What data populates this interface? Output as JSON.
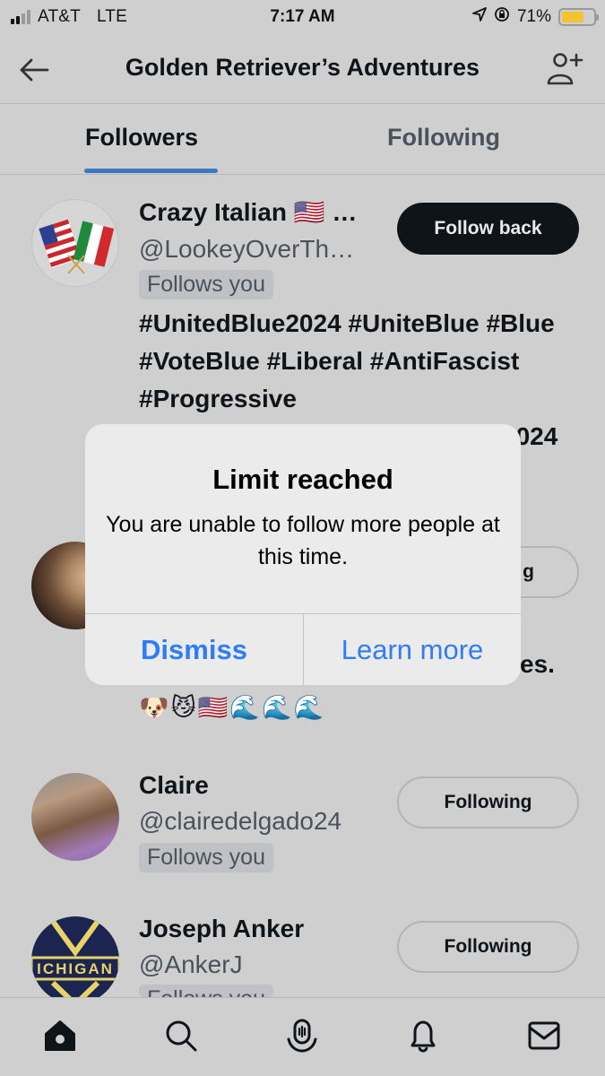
{
  "status_bar": {
    "carrier": "AT&T",
    "network": "LTE",
    "time": "7:17 AM",
    "battery_percent_label": "71%",
    "battery_level": 0.71,
    "signal_bars_active": 2,
    "signal_bars_total": 4,
    "icons": [
      "location-arrow-icon",
      "rotation-lock-icon",
      "battery-icon"
    ]
  },
  "header": {
    "title": "Golden Retriever’s Adventures",
    "back_icon": "arrow-left-icon",
    "add_user_icon": "person-plus-icon"
  },
  "tabs": [
    {
      "label": "Followers",
      "active": true
    },
    {
      "label": "Following",
      "active": false
    }
  ],
  "users": [
    {
      "name": "Crazy Italian 🇺🇸 …",
      "handle": "@LookeyOverTh…",
      "badge": "Follows you",
      "button": "Follow back",
      "bio": "#UnitedBlue2024 #UniteBlue #Blue #VoteBlue #Liberal #AntiFascist #Progressive",
      "bio_overflow": "2024",
      "avatar": "us-italy-flags-avatar"
    },
    {
      "name": "",
      "handle": "",
      "button_partial": "g",
      "bio_tail": "es.",
      "emojis": "🐶😼🇺🇸🌊🌊🌊",
      "avatar": "woman-blonde-avatar"
    },
    {
      "name": "Claire",
      "handle": "@clairedelgado24",
      "badge": "Follows you",
      "button": "Following",
      "avatar": "woman-purple-top-avatar"
    },
    {
      "name": "Joseph Anker",
      "handle": "@AnkerJ",
      "badge": "Follows you",
      "button": "Following",
      "avatar": "michigan-logo-avatar"
    }
  ],
  "alert": {
    "title": "Limit reached",
    "message": "You are unable to follow more people at this time.",
    "dismiss_label": "Dismiss",
    "learn_more_label": "Learn more",
    "accent_color": "#2e7cf6"
  },
  "bottom_nav": [
    {
      "name": "home",
      "icon": "home-icon",
      "active": true
    },
    {
      "name": "search",
      "icon": "search-icon",
      "active": false
    },
    {
      "name": "spaces",
      "icon": "spaces-microphone-icon",
      "active": false
    },
    {
      "name": "notifications",
      "icon": "bell-icon",
      "active": false
    },
    {
      "name": "messages",
      "icon": "mail-icon",
      "active": false
    }
  ],
  "colors": {
    "background": "#cfcfd0",
    "tab_indicator": "#3b79c2",
    "follow_back_bg": "#0f1419",
    "battery_fill": "#f4c430"
  }
}
